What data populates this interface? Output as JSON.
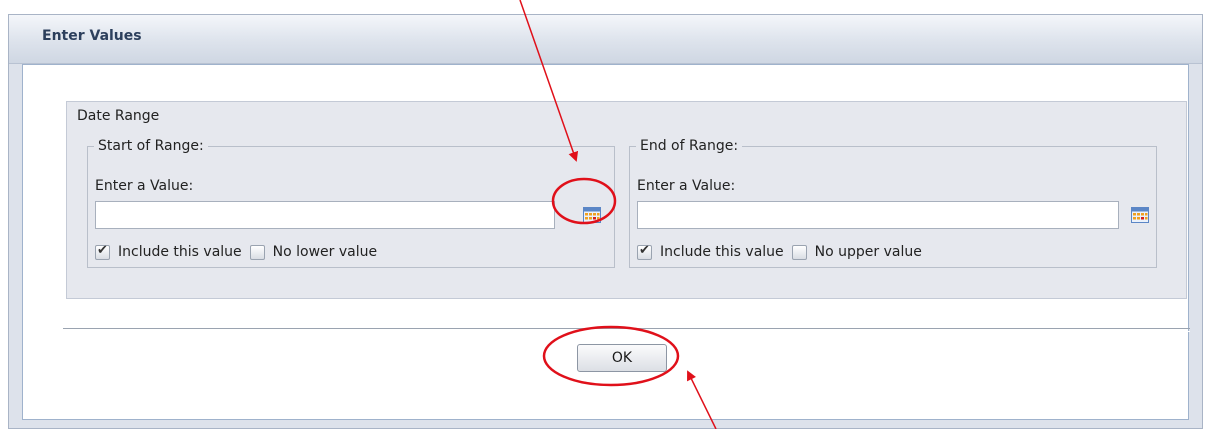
{
  "dialog": {
    "title": "Enter Values"
  },
  "date_range": {
    "legend": "Date Range",
    "start": {
      "legend": "Start of Range:",
      "value_label": "Enter a Value:",
      "value": "",
      "include_label": "Include this value",
      "include_checked": true,
      "open_label": "No lower value",
      "open_checked": false
    },
    "end": {
      "legend": "End of Range:",
      "value_label": "Enter a Value:",
      "value": "",
      "include_label": "Include this value",
      "include_checked": true,
      "open_label": "No upper value",
      "open_checked": false
    }
  },
  "buttons": {
    "ok_label": "OK"
  },
  "annotations": {
    "color": "#e0101a"
  },
  "icons": [
    "calendar-icon",
    "calendar-icon",
    "checkbox-icon"
  ]
}
